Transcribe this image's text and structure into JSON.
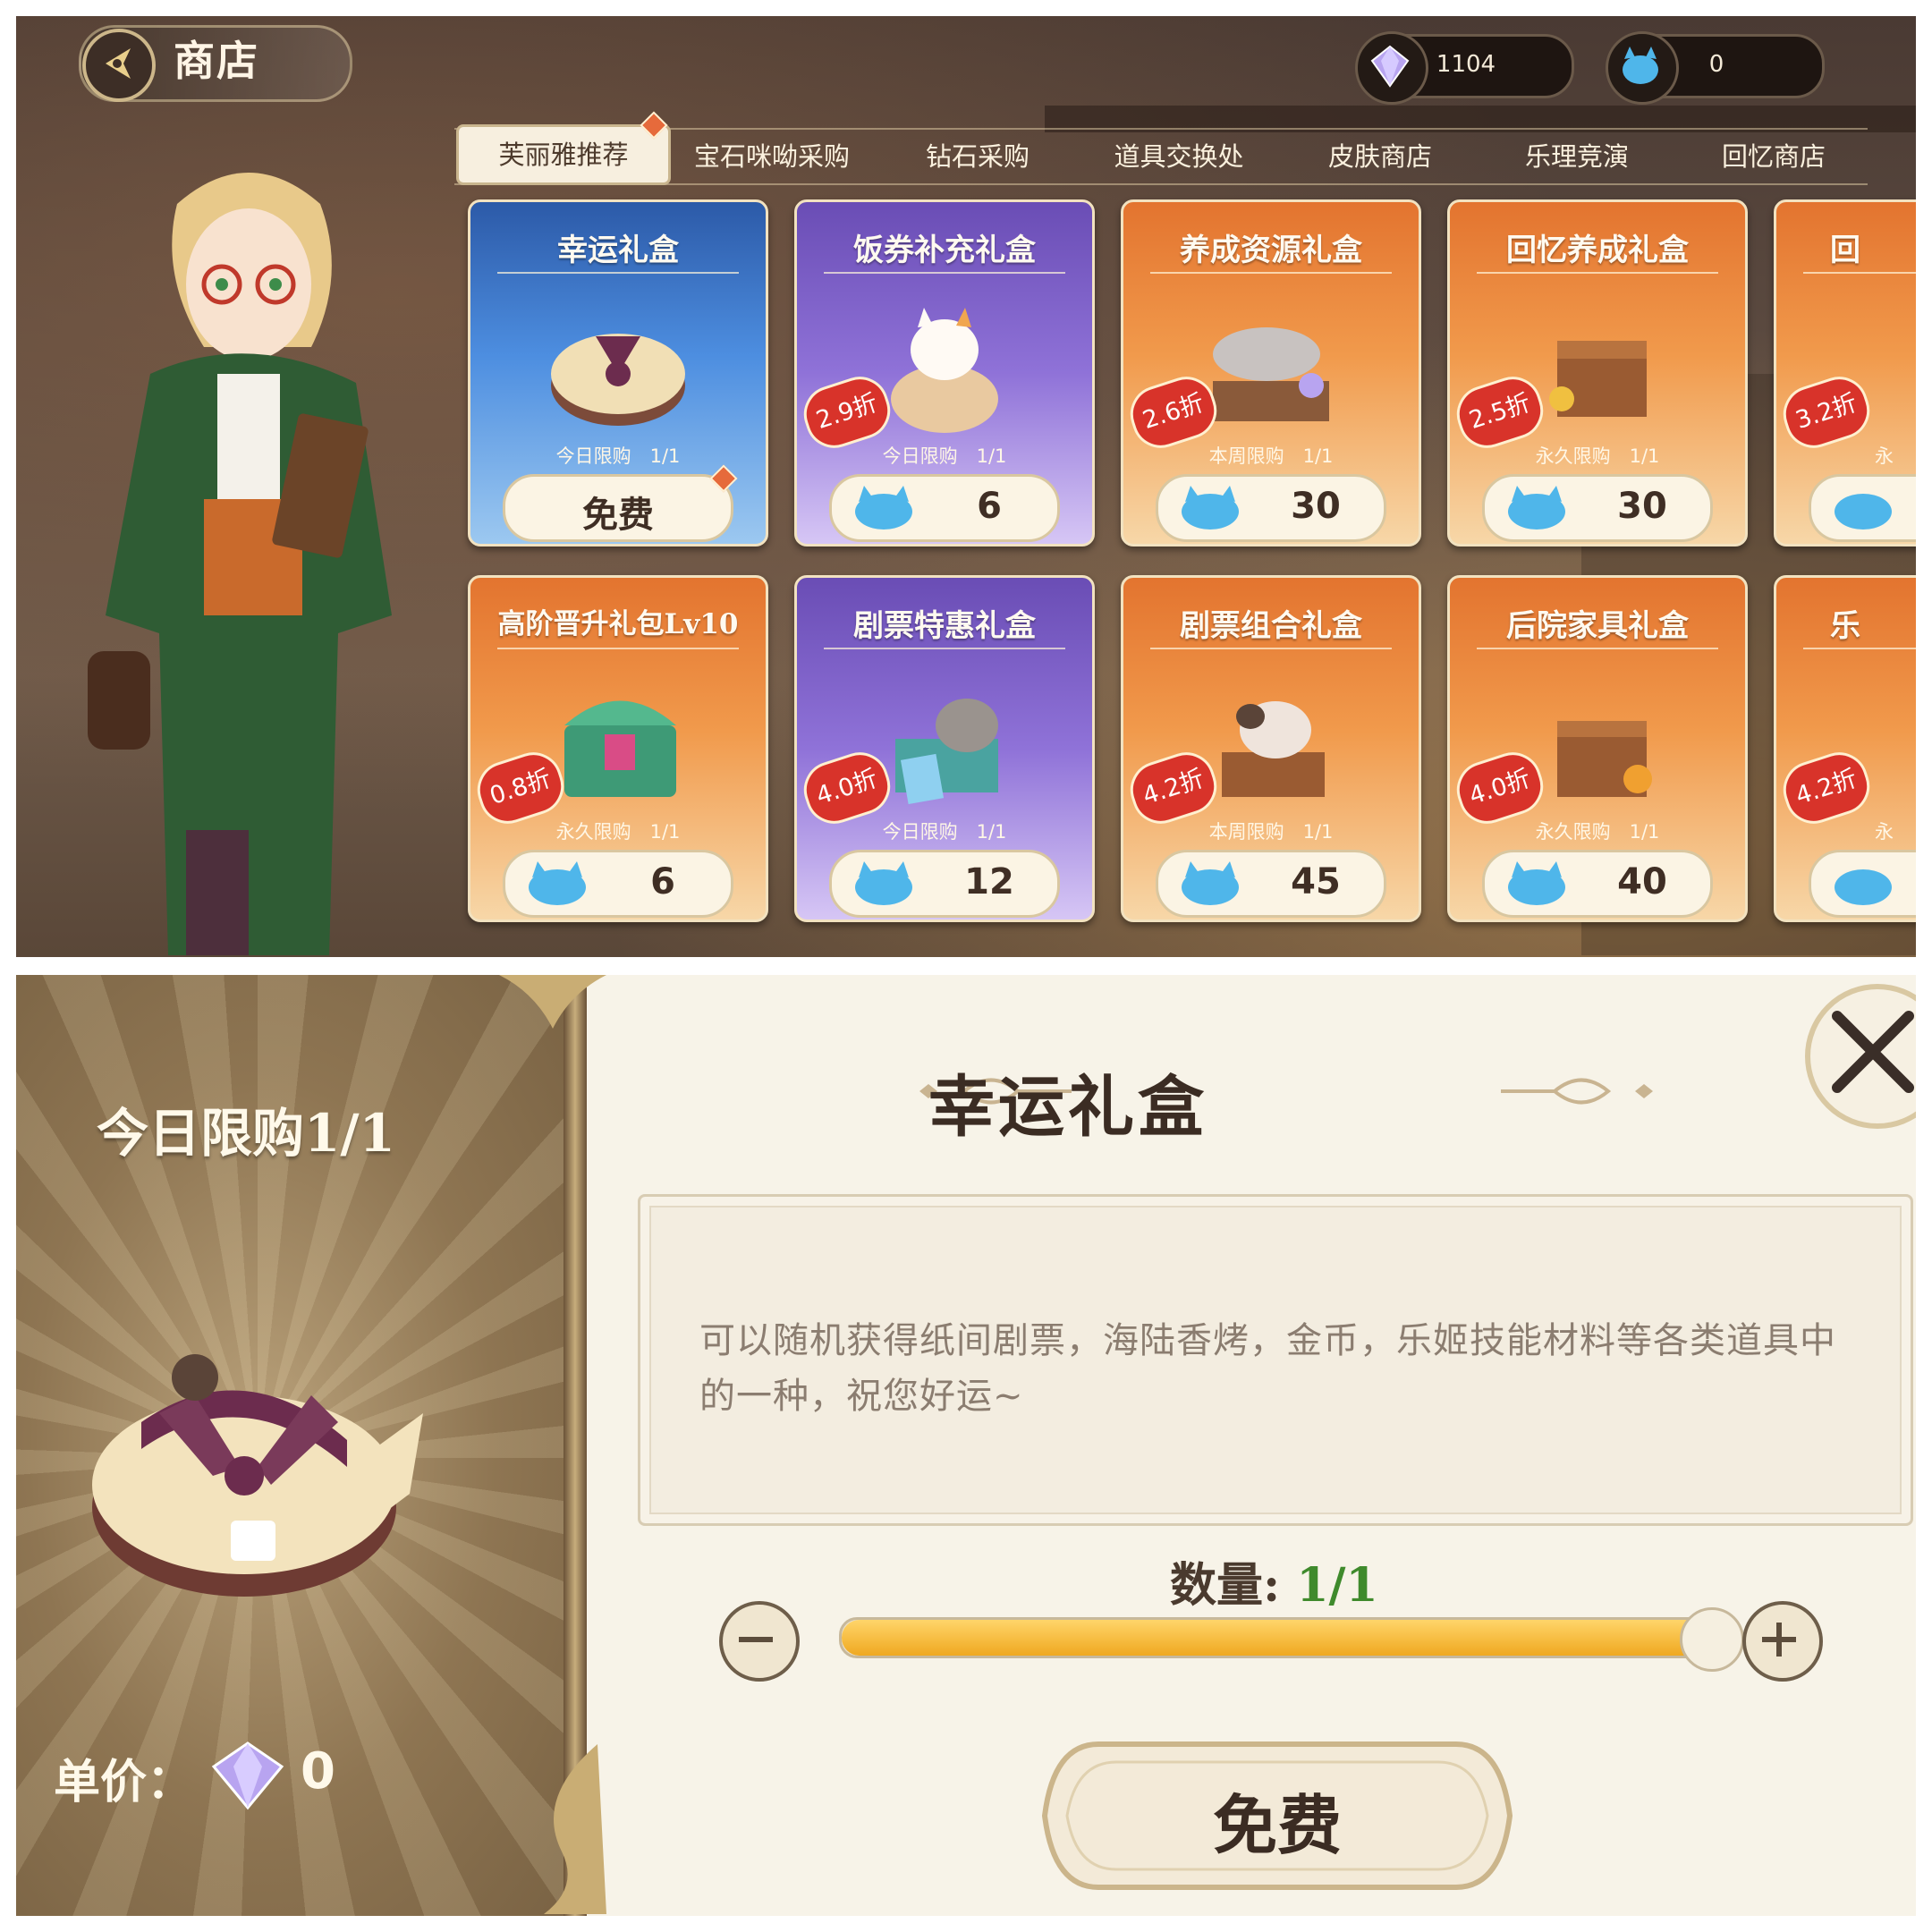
{
  "shop": {
    "title": "商店",
    "currencies": [
      {
        "icon": "gem-icon",
        "value": "1104"
      },
      {
        "icon": "cat-coin-icon",
        "value": "0"
      }
    ],
    "tabs": [
      {
        "label": "芙丽雅推荐",
        "active": true
      },
      {
        "label": "宝石咪呦采购"
      },
      {
        "label": "钻石采购"
      },
      {
        "label": "道具交换处"
      },
      {
        "label": "皮肤商店"
      },
      {
        "label": "乐理竞演"
      },
      {
        "label": "回忆商店"
      }
    ],
    "cards": [
      {
        "name": "幸运礼盒",
        "limit": "今日限购　1/1",
        "price": "免费",
        "color": "blue",
        "discount": ""
      },
      {
        "name": "饭券补充礼盒",
        "limit": "今日限购　1/1",
        "price": "6",
        "color": "purple",
        "discount": "2.9折"
      },
      {
        "name": "养成资源礼盒",
        "limit": "本周限购　1/1",
        "price": "30",
        "color": "orange",
        "discount": "2.6折"
      },
      {
        "name": "回忆养成礼盒",
        "limit": "永久限购　1/1",
        "price": "30",
        "color": "orange",
        "discount": "2.5折"
      },
      {
        "name": "回",
        "limit": "永",
        "price": "",
        "color": "orange",
        "discount": "3.2折"
      },
      {
        "name": "高阶晋升礼包Lv10",
        "limit": "永久限购　1/1",
        "price": "6",
        "color": "orange",
        "discount": "0.8折"
      },
      {
        "name": "剧票特惠礼盒",
        "limit": "今日限购　1/1",
        "price": "12",
        "color": "purple",
        "discount": "4.0折"
      },
      {
        "name": "剧票组合礼盒",
        "limit": "本周限购　1/1",
        "price": "45",
        "color": "orange",
        "discount": "4.2折"
      },
      {
        "name": "后院家具礼盒",
        "limit": "永久限购　1/1",
        "price": "40",
        "color": "orange",
        "discount": "4.0折"
      },
      {
        "name": "乐",
        "limit": "永",
        "price": "",
        "color": "orange",
        "discount": "4.2折"
      }
    ],
    "colors": {
      "accent": "#e3742f",
      "badge": "#d8332a"
    }
  },
  "dialog": {
    "limit": "今日限购1/1",
    "title": "幸运礼盒",
    "description": "可以随机获得纸间剧票，海陆香烤，金币，乐姬技能材料等各类道具中的一种，祝您好运~",
    "quantity_label": "数量:",
    "quantity_value": "1/1",
    "quantity_fraction": 1.0,
    "unit_price_label": "单价：",
    "unit_price_value": "0",
    "buy_label": "免费",
    "icons": [
      "gift-box-icon",
      "gem-icon",
      "close-icon",
      "minus-icon",
      "plus-icon"
    ]
  }
}
